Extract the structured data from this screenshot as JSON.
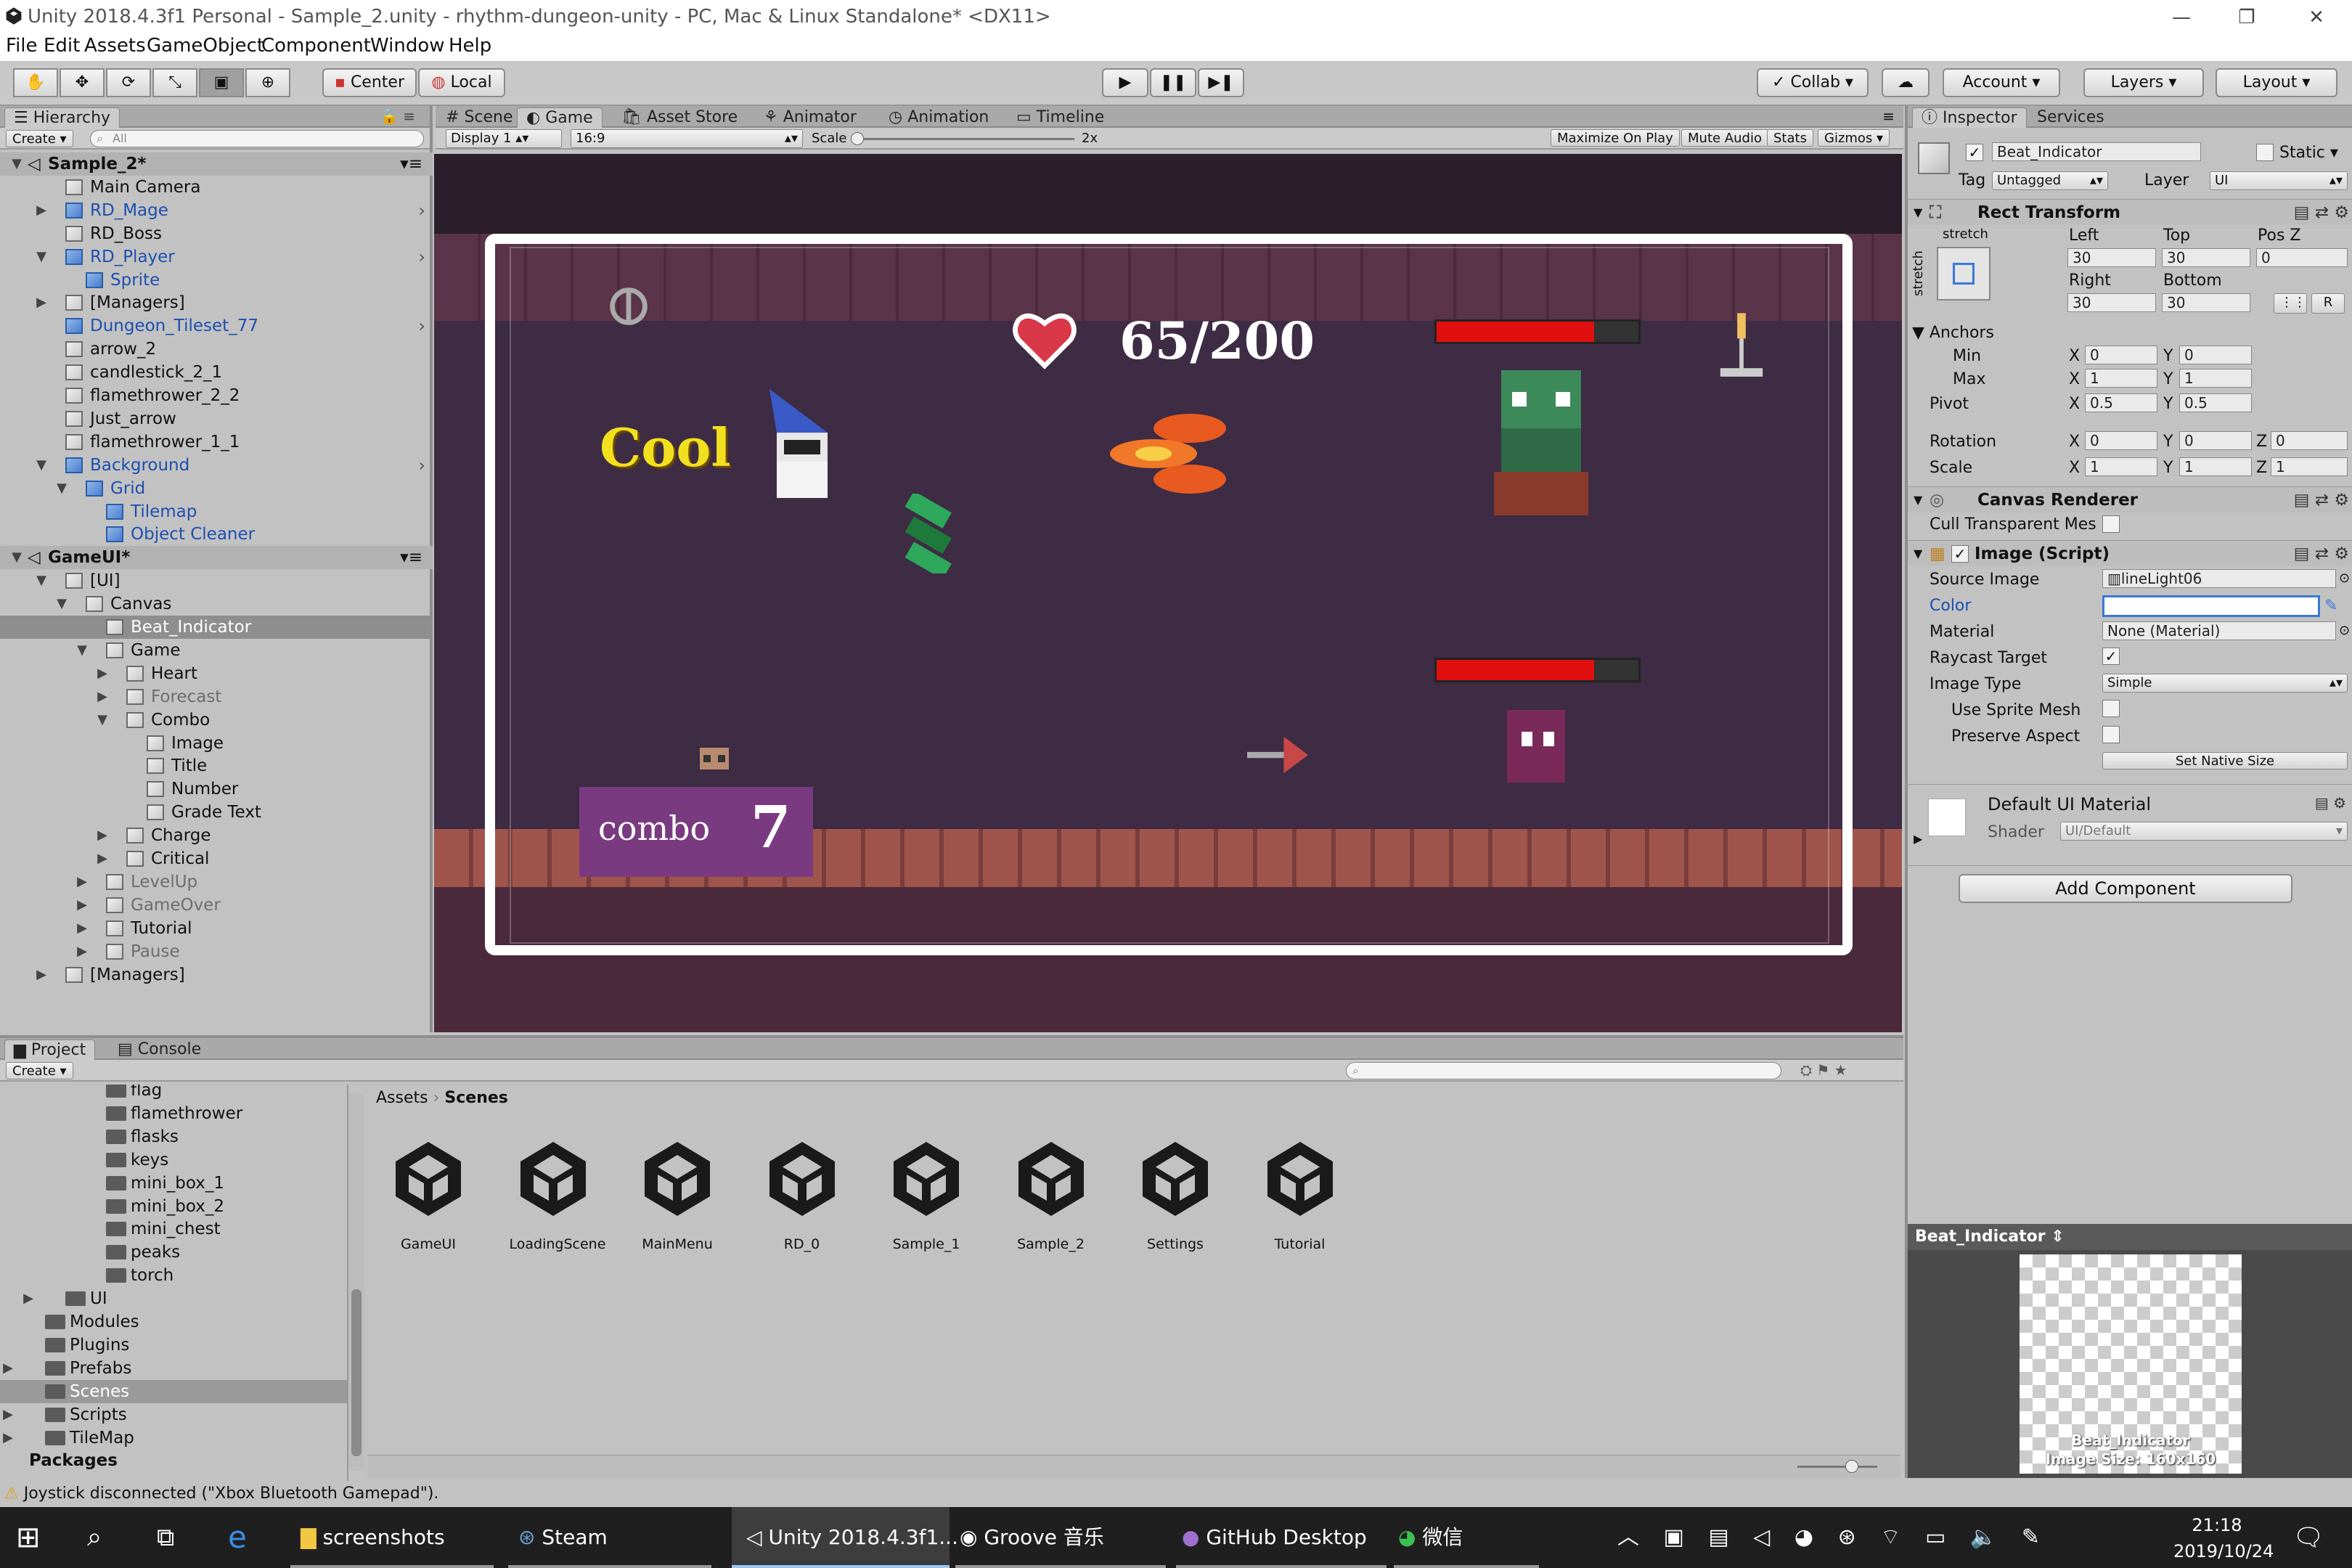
{
  "window": {
    "title": "Unity 2018.4.3f1 Personal - Sample_2.unity - rhythm-dungeon-unity - PC, Mac & Linux Standalone* <DX11>",
    "controls": [
      "—",
      "❐",
      "✕"
    ]
  },
  "menu": [
    "File",
    "Edit",
    "Assets",
    "GameObject",
    "Component",
    "Window",
    "Help"
  ],
  "toolbar": {
    "pivot_label": "Center",
    "space_label": "Local",
    "collab_label": "Collab",
    "account_label": "Account",
    "layers_label": "Layers",
    "layout_label": "Layout"
  },
  "hierarchy": {
    "tab": "Hierarchy",
    "create": "Create",
    "search_placeholder": "All",
    "rows": [
      {
        "label": "Sample_2*",
        "kind": "scene"
      },
      {
        "label": "Main Camera",
        "kind": "obj"
      },
      {
        "label": "RD_Mage",
        "kind": "prefab"
      },
      {
        "label": "RD_Boss",
        "kind": "obj"
      },
      {
        "label": "RD_Player",
        "kind": "prefab"
      },
      {
        "label": "Sprite",
        "kind": "prefab"
      },
      {
        "label": "[Managers]",
        "kind": "obj"
      },
      {
        "label": "Dungeon_Tileset_77",
        "kind": "prefab"
      },
      {
        "label": "arrow_2",
        "kind": "obj"
      },
      {
        "label": "candlestick_2_1",
        "kind": "obj"
      },
      {
        "label": "flamethrower_2_2",
        "kind": "obj"
      },
      {
        "label": "Just_arrow",
        "kind": "obj"
      },
      {
        "label": "flamethrower_1_1",
        "kind": "obj"
      },
      {
        "label": "Background",
        "kind": "prefab"
      },
      {
        "label": "Grid",
        "kind": "prefab"
      },
      {
        "label": "Tilemap",
        "kind": "prefab"
      },
      {
        "label": "Object Cleaner",
        "kind": "prefab"
      },
      {
        "label": "GameUI*",
        "kind": "scene"
      },
      {
        "label": "[UI]",
        "kind": "obj"
      },
      {
        "label": "Canvas",
        "kind": "obj"
      },
      {
        "label": "Beat_Indicator",
        "kind": "selected"
      },
      {
        "label": "Game",
        "kind": "obj"
      },
      {
        "label": "Heart",
        "kind": "obj"
      },
      {
        "label": "Forecast",
        "kind": "inactive"
      },
      {
        "label": "Combo",
        "kind": "obj"
      },
      {
        "label": "Image",
        "kind": "obj"
      },
      {
        "label": "Title",
        "kind": "obj"
      },
      {
        "label": "Number",
        "kind": "obj"
      },
      {
        "label": "Grade Text",
        "kind": "obj"
      },
      {
        "label": "Charge",
        "kind": "obj"
      },
      {
        "label": "Critical",
        "kind": "obj"
      },
      {
        "label": "LevelUp",
        "kind": "inactive"
      },
      {
        "label": "GameOver",
        "kind": "inactive"
      },
      {
        "label": "Tutorial",
        "kind": "obj"
      },
      {
        "label": "Pause",
        "kind": "inactive"
      },
      {
        "label": "[Managers]",
        "kind": "obj"
      }
    ]
  },
  "center_tabs": [
    "Scene",
    "Game",
    "Asset Store",
    "Animator",
    "Animation",
    "Timeline"
  ],
  "game_bar": {
    "display": "Display 1",
    "aspect": "16:9",
    "scale_label": "Scale",
    "scale_value": "2x",
    "buttons": [
      "Maximize On Play",
      "Mute Audio",
      "Stats",
      "Gizmos"
    ]
  },
  "game": {
    "hp_text": "65/200",
    "grade_text": "Cool",
    "combo_label": "combo",
    "combo_value": "7",
    "enemy1_health": 0.78,
    "enemy2_health": 0.78
  },
  "inspector": {
    "tabs": [
      "Inspector",
      "Services"
    ],
    "object_name": "Beat_Indicator",
    "static_label": "Static",
    "tag_label": "Tag",
    "tag_value": "Untagged",
    "layer_label": "Layer",
    "layer_value": "UI",
    "rect": {
      "title": "Rect Transform",
      "stretch": "stretch",
      "left_label": "Left",
      "left": "30",
      "top_label": "Top",
      "top": "30",
      "posz_label": "Pos Z",
      "posz": "0",
      "right_label": "Right",
      "right": "30",
      "bottom_label": "Bottom",
      "bottom": "30",
      "r_btn": "R",
      "anchors_label": "Anchors",
      "min_label": "Min",
      "min_x": "0",
      "min_y": "0",
      "max_label": "Max",
      "max_x": "1",
      "max_y": "1",
      "pivot_label": "Pivot",
      "pivot_x": "0.5",
      "pivot_y": "0.5",
      "rotation_label": "Rotation",
      "rot_x": "0",
      "rot_y": "0",
      "rot_z": "0",
      "scale_label": "Scale",
      "scale_x": "1",
      "scale_y": "1",
      "scale_z": "1"
    },
    "canvas_renderer": {
      "title": "Canvas Renderer",
      "cull_label": "Cull Transparent Mes"
    },
    "image": {
      "title": "Image (Script)",
      "source_label": "Source Image",
      "source": "lineLight06",
      "color_label": "Color",
      "material_label": "Material",
      "material": "None (Material)",
      "raycast_label": "Raycast Target",
      "type_label": "Image Type",
      "type": "Simple",
      "sprite_mesh_label": "Use Sprite Mesh",
      "preserve_label": "Preserve Aspect",
      "native_btn": "Set Native Size"
    },
    "material": {
      "name": "Default UI Material",
      "shader_label": "Shader",
      "shader": "UI/Default"
    },
    "add_component": "Add Component",
    "preview_title": "Beat_Indicator",
    "preview_caption1": "Beat_Indicator",
    "preview_caption2": "Image Size: 160x160"
  },
  "project": {
    "tabs": [
      "Project",
      "Console"
    ],
    "create": "Create",
    "tree": [
      {
        "label": "flag",
        "level": 2
      },
      {
        "label": "flamethrower",
        "level": 2
      },
      {
        "label": "flasks",
        "level": 2
      },
      {
        "label": "keys",
        "level": 2
      },
      {
        "label": "mini_box_1",
        "level": 2
      },
      {
        "label": "mini_box_2",
        "level": 2
      },
      {
        "label": "mini_chest",
        "level": 2
      },
      {
        "label": "peaks",
        "level": 2
      },
      {
        "label": "torch",
        "level": 2
      },
      {
        "label": "UI",
        "level": 1
      },
      {
        "label": "Modules",
        "level": 0
      },
      {
        "label": "Plugins",
        "level": 0
      },
      {
        "label": "Prefabs",
        "level": 0
      },
      {
        "label": "Scenes",
        "level": 0
      },
      {
        "label": "Scripts",
        "level": 0
      },
      {
        "label": "TileMap",
        "level": 0
      },
      {
        "label": "Packages",
        "level": -1
      }
    ],
    "breadcrumb_root": "Assets",
    "breadcrumb_leaf": "Scenes",
    "assets": [
      "GameUI",
      "LoadingScene",
      "MainMenu",
      "RD_0",
      "Sample_1",
      "Sample_2",
      "Settings",
      "Tutorial"
    ]
  },
  "status": "Joystick disconnected (\"Xbox Bluetooth Gamepad\").",
  "taskbar": {
    "items": [
      "screenshots",
      "Steam",
      "Unity 2018.4.3f1...",
      "Groove 音乐",
      "GitHub Desktop",
      "微信"
    ],
    "time": "21:18",
    "date": "2019/10/24"
  }
}
